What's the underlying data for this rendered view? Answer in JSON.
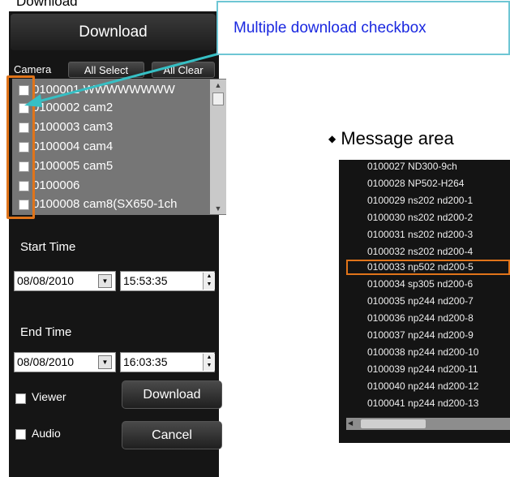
{
  "doc_title": "Download",
  "panel": {
    "header_title": "Download",
    "camera_label": "Camera",
    "all_select": "All Select",
    "all_clear": "All Clear",
    "cameras": [
      "0100001 WWWWWWWW",
      "0100002 cam2",
      "0100003 cam3",
      "0100004 cam4",
      "0100005 cam5",
      "0100006",
      "0100008 cam8(SX650-1ch"
    ],
    "start_time_label": "Start Time",
    "start_date": "08/08/2010",
    "start_time": "15:53:35",
    "end_time_label": "End Time",
    "end_date": "08/08/2010",
    "end_time": "16:03:35",
    "viewer_label": "Viewer",
    "audio_label": "Audio",
    "download_button": "Download",
    "cancel_button": "Cancel"
  },
  "callout": "Multiple download checkbox",
  "message_area": {
    "heading": "Message area",
    "lines": [
      "0100027 ND300-9ch",
      "0100028 NP502-H264",
      "0100029 ns202 nd200-1",
      "0100030 ns202 nd200-2",
      "0100031 ns202 nd200-3",
      "0100032 ns202 nd200-4",
      "0100033 np502 nd200-5",
      "0100034 sp305 nd200-6",
      "0100035 np244 nd200-7",
      "0100036 np244 nd200-8",
      "0100037 np244 nd200-9",
      "0100038 np244 nd200-10",
      "0100039 np244 nd200-11",
      "0100040 np244 nd200-12",
      "0100041 np244 nd200-13"
    ]
  },
  "colors": {
    "highlight": "#e0741a",
    "callout_border": "#6ec6d4",
    "callout_text": "#1a28e0",
    "panel_bg": "#151515",
    "list_bg": "#767676"
  }
}
